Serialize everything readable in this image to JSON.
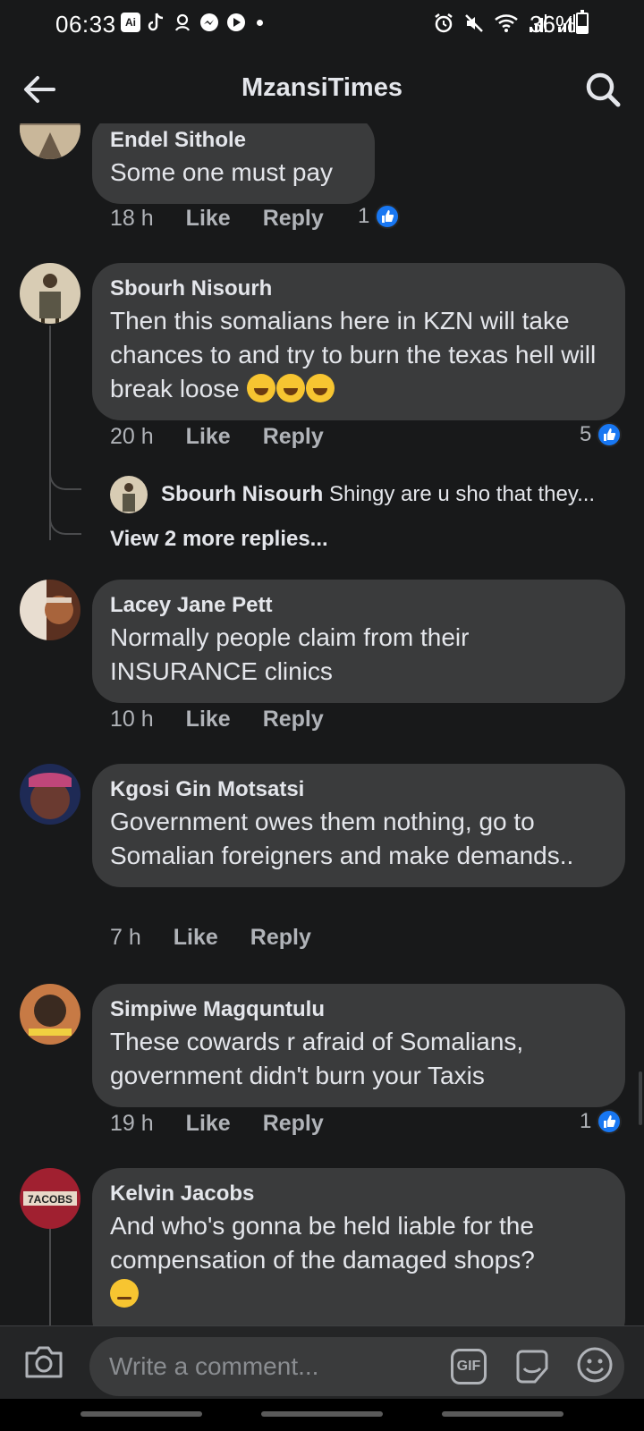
{
  "status_bar": {
    "time": "06:33",
    "app_badge": "Ai",
    "battery_pct": "36%",
    "battery_level": 0.36
  },
  "header": {
    "title": "MzansiTimes",
    "back_icon": "arrow-left-icon",
    "search_icon": "search-icon"
  },
  "comments": [
    {
      "name": "Endel Sithole",
      "text": "Some one must pay",
      "time": "18 h",
      "like_label": "Like",
      "reply_label": "Reply",
      "reaction_count": "1",
      "avatar_colors": [
        "#8a7a66",
        "#c9b79a"
      ]
    },
    {
      "name": "Sbourh Nisourh",
      "text": "Then this somalians here in KZN will take chances to and try to burn the texas hell will break loose",
      "time": "20 h",
      "like_label": "Like",
      "reply_label": "Reply",
      "reaction_count": "5",
      "avatar_colors": [
        "#d8ccb4",
        "#5a5646"
      ],
      "reply_preview": {
        "name": "Sbourh Nisourh",
        "text": "Shingy are u sho that they..."
      },
      "more_replies": "View 2 more replies..."
    },
    {
      "name": "Lacey Jane Pett",
      "text": "Normally people claim from their INSURANCE clinics",
      "time": "10 h",
      "like_label": "Like",
      "reply_label": "Reply",
      "avatar_colors": [
        "#5a3020",
        "#a8643c"
      ]
    },
    {
      "name": "Kgosi Gin Motsatsi",
      "text": "Government owes them  nothing, go to Somalian foreigners and make demands..",
      "time": "7 h",
      "like_label": "Like",
      "reply_label": "Reply",
      "avatar_colors": [
        "#1e2a55",
        "#c0467a"
      ]
    },
    {
      "name": "Simpiwe Magquntulu",
      "text": "These cowards r afraid of Somalians, government didn't burn your Taxis",
      "time": "19 h",
      "like_label": "Like",
      "reply_label": "Reply",
      "reaction_count": "1",
      "avatar_colors": [
        "#c77a45",
        "#3a2a20"
      ]
    },
    {
      "name": "Kelvin Jacobs",
      "text": "And who's gonna be held liable for the compensation of the damaged shops?",
      "avatar_colors": [
        "#a02030",
        "#e8d8c8"
      ],
      "avatar_label": "7ACOBS"
    }
  ],
  "composer": {
    "placeholder": "Write a comment...",
    "gif_label": "GIF",
    "camera_icon": "camera-icon",
    "sticker_icon": "sticker-icon",
    "emoji_icon": "smiley-icon"
  },
  "colors": {
    "background": "#18191a",
    "bubble": "#3a3b3c",
    "text_primary": "#e4e6eb",
    "text_secondary": "#b0b3b8",
    "like_blue": "#1877f2"
  }
}
